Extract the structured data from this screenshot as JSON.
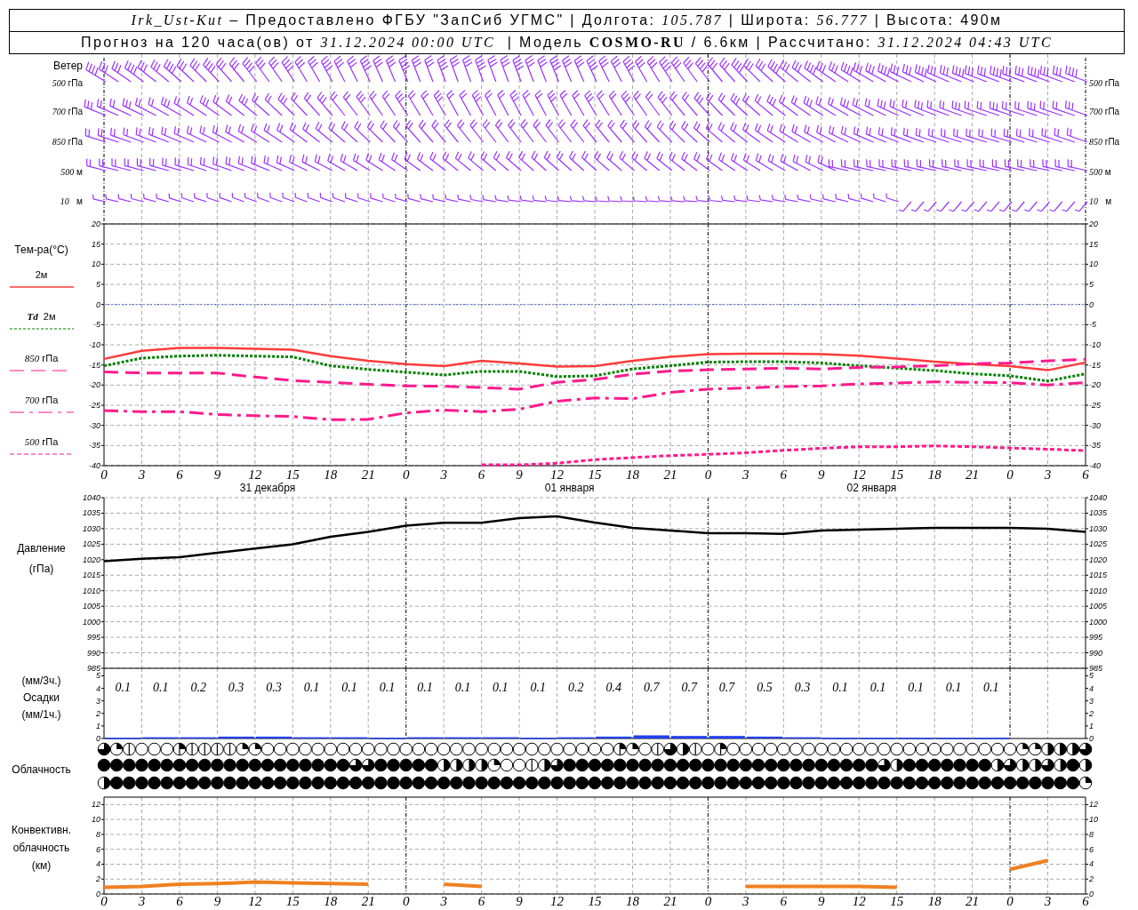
{
  "header": {
    "line1": "*Irk_Ust-Kut* – Предоставлено ФГБУ \"ЗапСиб УГМС\" | Долгота: *105.787* | Широта: *56.777* | Высота: 490м",
    "line2": "Прогноз на 120 часа(ов) от *31.12.2024 00:00 UTC*  | Модель **COSMO-RU** / 6.6км | Рассчитано: *31.12.2024 04:43 UTC*"
  },
  "wind": {
    "title": "Ветер",
    "levels": [
      {
        "label": "*500* гПа",
        "right_label": "*500* гПа"
      },
      {
        "label": "*700* гПа",
        "right_label": "*700* гПа"
      },
      {
        "label": "*850* гПа",
        "right_label": "*850* гПа"
      },
      {
        "label": "*500* м",
        "right_label": "*500* м"
      },
      {
        "label": "*10*   м",
        "right_label": "*10*   м"
      }
    ]
  },
  "temperature": {
    "title": "Тем-ра(°C)",
    "days": [
      "31 декабря",
      "01 января",
      "02 января"
    ],
    "right_axis_labels": [
      "20",
      "15",
      "10",
      "5",
      "0",
      "-5",
      "-10",
      "-15",
      "-20",
      "-25",
      "-30",
      "-35",
      "-40"
    ],
    "chart_data": {
      "type": "line",
      "grid": true,
      "ylim": [
        -40,
        20
      ],
      "categories": [
        "0",
        "3",
        "6",
        "9",
        "12",
        "15",
        "18",
        "21",
        "0",
        "3",
        "6",
        "9",
        "12",
        "15",
        "18",
        "21",
        "0",
        "3",
        "6",
        "9",
        "12",
        "15",
        "18",
        "21",
        "0",
        "3",
        "6"
      ],
      "yticks": [
        20,
        15,
        10,
        5,
        0,
        -5,
        -10,
        -15,
        -20,
        -25,
        -30,
        -35,
        -40
      ],
      "series": [
        {
          "name": "2м",
          "color": "#ff3b3b",
          "line_style": "solid",
          "values": [
            -13.5,
            -11.5,
            -10.8,
            -10.8,
            -11,
            -11.2,
            -12.8,
            -14,
            -14.8,
            -15.3,
            -14,
            -14.6,
            -15.4,
            -15.3,
            -14,
            -13,
            -12.3,
            -12.2,
            -12.2,
            -12.3,
            -12.7,
            -13.4,
            -14.2,
            -14.8,
            -15.3,
            -16.3,
            -14.4
          ]
        },
        {
          "name": "**Td**  2м",
          "color": "#008000",
          "line_style": "dotted",
          "values": [
            -15.2,
            -13.3,
            -12.8,
            -12.6,
            -12.8,
            -13,
            -15.2,
            -16.1,
            -16.8,
            -17.5,
            -16.6,
            -16.6,
            -17.9,
            -17.7,
            -16,
            -15.2,
            -14.3,
            -14.2,
            -14.2,
            -14.5,
            -15.2,
            -15.8,
            -16.4,
            -17.2,
            -17.7,
            -19,
            -17.2
          ]
        },
        {
          "name": "*850* гПа",
          "color": "#ff1a8c",
          "line_style": "dashed",
          "values": [
            -16.7,
            -17,
            -17,
            -17,
            -18,
            -18.9,
            -19.3,
            -19.8,
            -20.2,
            -20.3,
            -20.6,
            -21,
            -19.3,
            -18.6,
            -17.3,
            -16.5,
            -16.2,
            -16,
            -15.8,
            -16,
            -15.6,
            -15.5,
            -15.2,
            -14.7,
            -14.5,
            -14,
            -13.6
          ]
        },
        {
          "name": "*700* гПа",
          "color": "#ff1a8c",
          "line_style": "dashdot",
          "values": [
            -26.3,
            -26.6,
            -26.6,
            -27.3,
            -27.6,
            -27.8,
            -28.6,
            -28.5,
            -26.9,
            -26.2,
            -26.6,
            -26,
            -24,
            -23.2,
            -23.4,
            -21.8,
            -21,
            -20.7,
            -20.4,
            -20.2,
            -19.7,
            -19.5,
            -19.2,
            -19.3,
            -19.4,
            -20,
            -19.4
          ]
        },
        {
          "name": "*500* гПа",
          "color": "#ff1a8c",
          "line_style": "short_dashed",
          "values": [
            null,
            null,
            null,
            null,
            null,
            null,
            null,
            null,
            null,
            null,
            -39.8,
            -39.8,
            -39.4,
            -38.5,
            -38,
            -37.5,
            -37.2,
            -36.8,
            -36.2,
            -35.7,
            -35.3,
            -35.3,
            -35.1,
            -35.3,
            -35.6,
            -35.9,
            -36.3
          ]
        }
      ]
    }
  },
  "pressure": {
    "right_axis_labels": [
      "1040",
      "1035",
      "1030",
      "1025",
      "1020",
      "1015",
      "1010",
      "1005",
      "1000",
      "995",
      "990",
      "985"
    ],
    "chart_data": {
      "type": "line",
      "grid": true,
      "ylabel": "(гПа)",
      "ylim": [
        985,
        1040
      ],
      "yticks": [
        1040,
        1035,
        1030,
        1025,
        1020,
        1015,
        1010,
        1005,
        1000,
        995,
        990,
        985
      ],
      "series": [
        {
          "name": "Давление",
          "color": "#000000",
          "line_style": "solid",
          "values": [
            1019.5,
            1020.3,
            1020.8,
            1022.2,
            1023.6,
            1025,
            1027.4,
            1029,
            1031,
            1031.9,
            1031.9,
            1033.4,
            1034,
            1032,
            1030.3,
            1029.4,
            1028.5,
            1028.5,
            1028.3,
            1029.4,
            1029.7,
            1030,
            1030.3,
            1030.3,
            1030.3,
            1030,
            1029
          ]
        }
      ]
    }
  },
  "precipitation": {
    "labels": [
      "(мм/3ч.)",
      "Осадки",
      "(мм/1ч.)"
    ],
    "totals": [
      "0.1",
      "0.1",
      "0.2",
      "0.3",
      "0.3",
      "0.1",
      "0.1",
      "0.1",
      "0.1",
      "0.1",
      "0.1",
      "0.1",
      "0.2",
      "0.4",
      "0.7",
      "0.7",
      "0.7",
      "0.5",
      "0.3",
      "0.1",
      "0.1",
      "0.1",
      "0.1",
      "0.1"
    ],
    "right_axis_labels": [
      "5",
      "4",
      "3",
      "2",
      "1",
      "0"
    ],
    "chart_data": {
      "type": "bar",
      "grid": true,
      "ylim": [
        0,
        5.6
      ],
      "yticks": [
        5,
        4,
        3,
        2,
        1,
        0
      ],
      "values": [
        0.05,
        0.1,
        0.1,
        0.15,
        0.15,
        0.1,
        0.1,
        0.05,
        0.1,
        0.1,
        0.1,
        0.05,
        0.1,
        0.15,
        0.25,
        0.2,
        0.2,
        0.15,
        0.1,
        0.05,
        0.05,
        0.05,
        0.05,
        0.05,
        null,
        null
      ]
    }
  },
  "clouds": {
    "label": "Облачность",
    "rows": [
      {
        "cells": [
          {
            "kind": "three_quarters"
          },
          {
            "kind": "quarter"
          },
          {
            "kind": "eighth"
          },
          {
            "kind": "empty"
          },
          {
            "kind": "empty"
          },
          {
            "kind": "empty"
          },
          {
            "kind": "three_eighths"
          },
          {
            "kind": "eighth"
          },
          {
            "kind": "eighth"
          },
          {
            "kind": "eighth"
          },
          {
            "kind": "eighth"
          },
          {
            "kind": "quarter"
          },
          {
            "kind": "quarter"
          },
          {
            "kind": "empty"
          },
          {
            "kind": "empty"
          },
          {
            "kind": "empty"
          },
          {
            "kind": "empty"
          },
          {
            "kind": "empty"
          },
          {
            "kind": "empty"
          },
          {
            "kind": "empty"
          },
          {
            "kind": "empty"
          },
          {
            "kind": "empty"
          },
          {
            "kind": "empty"
          },
          {
            "kind": "empty"
          },
          {
            "kind": "empty"
          },
          {
            "kind": "empty"
          },
          {
            "kind": "empty"
          },
          {
            "kind": "empty"
          },
          {
            "kind": "empty"
          },
          {
            "kind": "empty"
          },
          {
            "kind": "empty"
          },
          {
            "kind": "empty"
          },
          {
            "kind": "empty"
          },
          {
            "kind": "empty"
          },
          {
            "kind": "empty"
          },
          {
            "kind": "empty"
          },
          {
            "kind": "empty"
          },
          {
            "kind": "empty"
          },
          {
            "kind": "empty"
          },
          {
            "kind": "empty"
          },
          {
            "kind": "empty"
          },
          {
            "kind": "three_eighths"
          },
          {
            "kind": "quarter"
          },
          {
            "kind": "empty"
          },
          {
            "kind": "eighth"
          },
          {
            "kind": "three_quarters"
          },
          {
            "kind": "half"
          },
          {
            "kind": "eighth"
          },
          {
            "kind": "empty"
          },
          {
            "kind": "three_eighths"
          },
          {
            "kind": "empty"
          },
          {
            "kind": "empty"
          },
          {
            "kind": "empty"
          },
          {
            "kind": "empty"
          },
          {
            "kind": "empty"
          },
          {
            "kind": "empty"
          },
          {
            "kind": "empty"
          },
          {
            "kind": "empty"
          },
          {
            "kind": "empty"
          },
          {
            "kind": "empty"
          },
          {
            "kind": "empty"
          },
          {
            "kind": "empty"
          },
          {
            "kind": "empty"
          },
          {
            "kind": "empty"
          },
          {
            "kind": "empty"
          },
          {
            "kind": "empty"
          },
          {
            "kind": "empty"
          },
          {
            "kind": "empty"
          },
          {
            "kind": "empty"
          },
          {
            "kind": "empty"
          },
          {
            "kind": "empty"
          },
          {
            "kind": "empty"
          },
          {
            "kind": "empty"
          },
          {
            "kind": "quarter"
          },
          {
            "kind": "quarter"
          },
          {
            "kind": "half"
          },
          {
            "kind": "five_eighths"
          },
          {
            "kind": "five_eighths"
          },
          {
            "kind": "three_quarters"
          }
        ]
      },
      {
        "cells": [
          {
            "kind": "full"
          },
          {
            "kind": "full"
          },
          {
            "kind": "full"
          },
          {
            "kind": "full"
          },
          {
            "kind": "full"
          },
          {
            "kind": "full"
          },
          {
            "kind": "full"
          },
          {
            "kind": "full"
          },
          {
            "kind": "full"
          },
          {
            "kind": "full"
          },
          {
            "kind": "full"
          },
          {
            "kind": "full"
          },
          {
            "kind": "full"
          },
          {
            "kind": "full"
          },
          {
            "kind": "full"
          },
          {
            "kind": "full"
          },
          {
            "kind": "full"
          },
          {
            "kind": "full"
          },
          {
            "kind": "full"
          },
          {
            "kind": "full"
          },
          {
            "kind": "three_quarters"
          },
          {
            "kind": "three_quarters"
          },
          {
            "kind": "full"
          },
          {
            "kind": "full"
          },
          {
            "kind": "full"
          },
          {
            "kind": "full"
          },
          {
            "kind": "full"
          },
          {
            "kind": "half"
          },
          {
            "kind": "half"
          },
          {
            "kind": "half"
          },
          {
            "kind": "half"
          },
          {
            "kind": "quarter"
          },
          {
            "kind": "empty"
          },
          {
            "kind": "empty"
          },
          {
            "kind": "eighth"
          },
          {
            "kind": "half"
          },
          {
            "kind": "three_quarters"
          },
          {
            "kind": "full"
          },
          {
            "kind": "full"
          },
          {
            "kind": "full"
          },
          {
            "kind": "full"
          },
          {
            "kind": "full"
          },
          {
            "kind": "full"
          },
          {
            "kind": "full"
          },
          {
            "kind": "full"
          },
          {
            "kind": "full"
          },
          {
            "kind": "full"
          },
          {
            "kind": "full"
          },
          {
            "kind": "full"
          },
          {
            "kind": "full"
          },
          {
            "kind": "full"
          },
          {
            "kind": "full"
          },
          {
            "kind": "full"
          },
          {
            "kind": "full"
          },
          {
            "kind": "full"
          },
          {
            "kind": "full"
          },
          {
            "kind": "full"
          },
          {
            "kind": "full"
          },
          {
            "kind": "full"
          },
          {
            "kind": "full"
          },
          {
            "kind": "full"
          },
          {
            "kind": "full"
          },
          {
            "kind": "three_quarters"
          },
          {
            "kind": "half"
          },
          {
            "kind": "full"
          },
          {
            "kind": "full"
          },
          {
            "kind": "full"
          },
          {
            "kind": "full"
          },
          {
            "kind": "full"
          },
          {
            "kind": "full"
          },
          {
            "kind": "full"
          },
          {
            "kind": "half"
          },
          {
            "kind": "three_quarters"
          },
          {
            "kind": "half"
          },
          {
            "kind": "half"
          },
          {
            "kind": "three_quarters"
          },
          {
            "kind": "half"
          },
          {
            "kind": "full"
          },
          {
            "kind": "half"
          }
        ]
      },
      {
        "cells": [
          {
            "kind": "half"
          },
          {
            "kind": "full"
          },
          {
            "kind": "full"
          },
          {
            "kind": "full"
          },
          {
            "kind": "full"
          },
          {
            "kind": "full"
          },
          {
            "kind": "full"
          },
          {
            "kind": "full"
          },
          {
            "kind": "full"
          },
          {
            "kind": "full"
          },
          {
            "kind": "full"
          },
          {
            "kind": "full"
          },
          {
            "kind": "full"
          },
          {
            "kind": "full"
          },
          {
            "kind": "full"
          },
          {
            "kind": "full"
          },
          {
            "kind": "full"
          },
          {
            "kind": "full"
          },
          {
            "kind": "full"
          },
          {
            "kind": "full"
          },
          {
            "kind": "full"
          },
          {
            "kind": "full"
          },
          {
            "kind": "full"
          },
          {
            "kind": "full"
          },
          {
            "kind": "full"
          },
          {
            "kind": "full"
          },
          {
            "kind": "full"
          },
          {
            "kind": "full"
          },
          {
            "kind": "full"
          },
          {
            "kind": "full"
          },
          {
            "kind": "full"
          },
          {
            "kind": "full"
          },
          {
            "kind": "full"
          },
          {
            "kind": "full"
          },
          {
            "kind": "full"
          },
          {
            "kind": "full"
          },
          {
            "kind": "full"
          },
          {
            "kind": "full"
          },
          {
            "kind": "full"
          },
          {
            "kind": "full"
          },
          {
            "kind": "full"
          },
          {
            "kind": "full"
          },
          {
            "kind": "full"
          },
          {
            "kind": "full"
          },
          {
            "kind": "full"
          },
          {
            "kind": "full"
          },
          {
            "kind": "full"
          },
          {
            "kind": "full"
          },
          {
            "kind": "full"
          },
          {
            "kind": "full"
          },
          {
            "kind": "full"
          },
          {
            "kind": "full"
          },
          {
            "kind": "full"
          },
          {
            "kind": "full"
          },
          {
            "kind": "full"
          },
          {
            "kind": "full"
          },
          {
            "kind": "full"
          },
          {
            "kind": "full"
          },
          {
            "kind": "full"
          },
          {
            "kind": "full"
          },
          {
            "kind": "full"
          },
          {
            "kind": "full"
          },
          {
            "kind": "full"
          },
          {
            "kind": "full"
          },
          {
            "kind": "full"
          },
          {
            "kind": "full"
          },
          {
            "kind": "full"
          },
          {
            "kind": "full"
          },
          {
            "kind": "full"
          },
          {
            "kind": "full"
          },
          {
            "kind": "full"
          },
          {
            "kind": "full"
          },
          {
            "kind": "full"
          },
          {
            "kind": "full"
          },
          {
            "kind": "full"
          },
          {
            "kind": "full"
          },
          {
            "kind": "full"
          },
          {
            "kind": "full"
          },
          {
            "kind": "quarter"
          }
        ]
      }
    ]
  },
  "convective": {
    "right_axis_labels": [
      "12",
      "10",
      "8",
      "6",
      "4",
      "2",
      "0"
    ],
    "chart_data": {
      "type": "line",
      "grid": true,
      "ylabel": "(км)",
      "ylim": [
        0,
        13
      ],
      "categories": [
        "0",
        "3",
        "6",
        "9",
        "12",
        "15",
        "18",
        "21",
        "0",
        "3",
        "6",
        "9",
        "12",
        "15",
        "18",
        "21",
        "0",
        "3",
        "6",
        "9",
        "12",
        "15",
        "18",
        "21",
        "0",
        "3",
        "6"
      ],
      "yticks": [
        12,
        10,
        8,
        6,
        4,
        2,
        0
      ],
      "series": [
        {
          "name": "Конвективн. облачность",
          "color": "#f08020",
          "values": [
            0.9,
            1.0,
            1.3,
            1.4,
            1.6,
            1.5,
            1.4,
            1.3,
            null,
            1.3,
            1.0,
            null,
            null,
            null,
            null,
            null,
            null,
            1.0,
            1.0,
            1.0,
            1.0,
            0.9,
            null,
            null,
            3.3,
            4.5,
            null
          ]
        }
      ]
    }
  }
}
